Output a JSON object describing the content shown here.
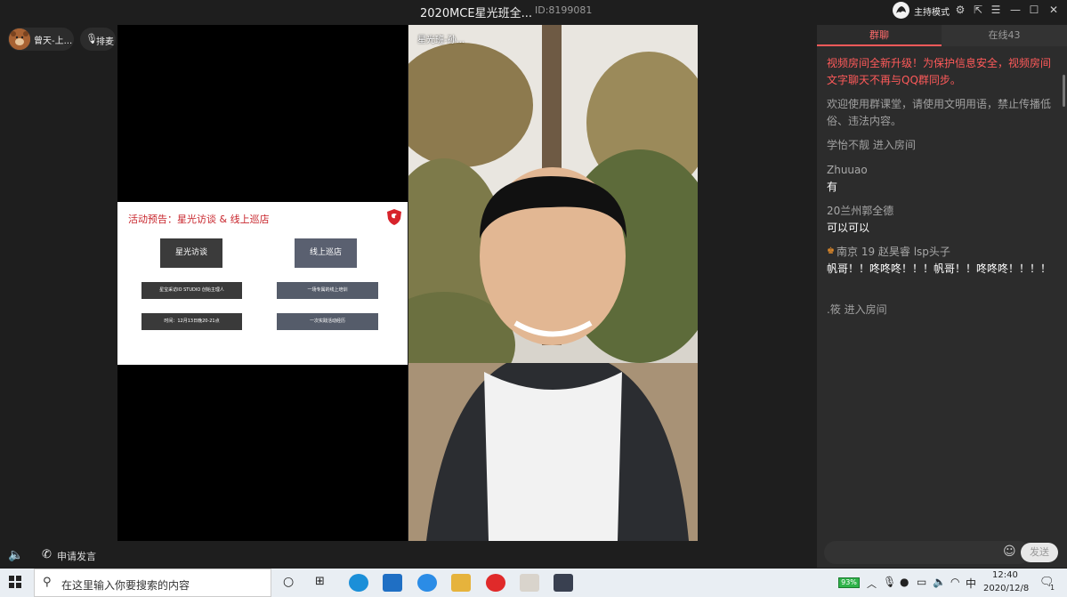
{
  "window": {
    "title": "2020MCE星光班全...",
    "room_id": "ID:8199081",
    "host_mode": "主持模式"
  },
  "left_bar": {
    "user_name": "曾天-上...",
    "queue_label": "排麦",
    "apply_speak": "申请发言"
  },
  "slide": {
    "title": "活动预告：星光访谈 & 线上巡店",
    "buttons": [
      "星光访谈",
      "线上巡店"
    ],
    "rows": [
      "星宝采访IO STUDIO 创始主理人",
      "一场专属的线上培训",
      "时间：12月13日晚20-21点",
      "一次实践活动经历"
    ]
  },
  "video": {
    "name": "星光班-孙..."
  },
  "chat": {
    "tabs": {
      "group": "群聊",
      "online": "在线43"
    },
    "notice": "视频房间全新升级！为保护信息安全，视频房间文字聊天不再与QQ群同步。",
    "welcome": "欢迎使用群课堂，请使用文明用语，禁止传播低俗、违法内容。",
    "messages": [
      {
        "type": "system",
        "text": "学怡不靓 进入房间"
      },
      {
        "type": "chat",
        "name": "Zhuuao",
        "text": "有"
      },
      {
        "type": "chat",
        "name": "20兰州郭全德",
        "text": "可以可以"
      },
      {
        "type": "chat",
        "name": "南京 19 赵昊睿 lsp头子",
        "text": "帆哥！！咚咚咚！！！帆哥！！咚咚咚！！！！"
      },
      {
        "type": "system",
        "text": ".筱 进入房间"
      }
    ],
    "send_label": "发送"
  },
  "taskbar": {
    "search_placeholder": "在这里输入你要搜索的内容",
    "battery": "93%",
    "ime": "中",
    "time": "12:40",
    "date": "2020/12/8",
    "notification_count": "1"
  }
}
